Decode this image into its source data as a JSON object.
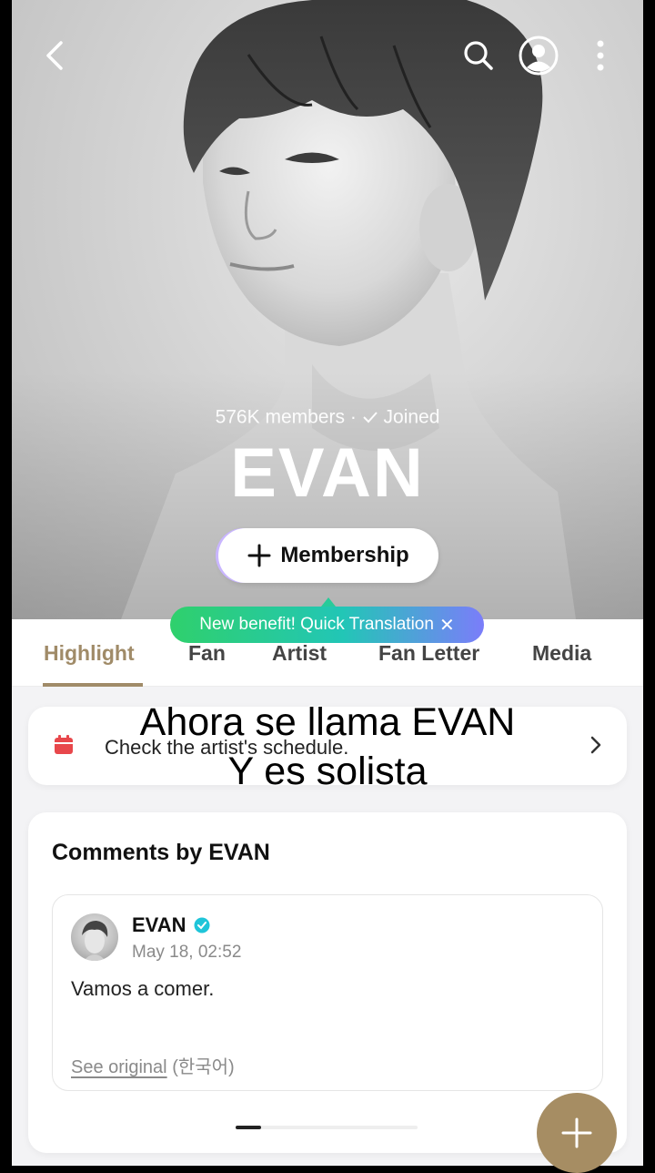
{
  "hero": {
    "members": "576K members",
    "separator": "·",
    "joined": "Joined",
    "artist_name": "EVAN",
    "membership_label": "Membership"
  },
  "tooltip": {
    "text": "New benefit! Quick Translation"
  },
  "tabs": [
    {
      "label": "Highlight",
      "active": true
    },
    {
      "label": "Fan",
      "active": false
    },
    {
      "label": "Artist",
      "active": false
    },
    {
      "label": "Fan Letter",
      "active": false
    },
    {
      "label": "Media",
      "active": false
    }
  ],
  "schedule": {
    "text": "Check the artist's schedule."
  },
  "comments": {
    "title": "Comments by EVAN",
    "author": "EVAN",
    "time": "May 18, 02:52",
    "text": "Vamos a comer.",
    "see_original": "See original",
    "language": "(한국어)"
  },
  "subtitle": {
    "line1": "Ahora se llama EVAN",
    "line2": "Y es solista"
  },
  "colors": {
    "accent": "#a08b68",
    "fab": "#a68d63",
    "calendar": "#e8474b",
    "verified": "#1fc5d9"
  },
  "icons": [
    "back-icon",
    "search-icon",
    "profile-icon",
    "more-icon",
    "plus-icon",
    "calendar-icon",
    "chevron-right-icon",
    "verified-icon",
    "close-icon",
    "check-icon"
  ]
}
